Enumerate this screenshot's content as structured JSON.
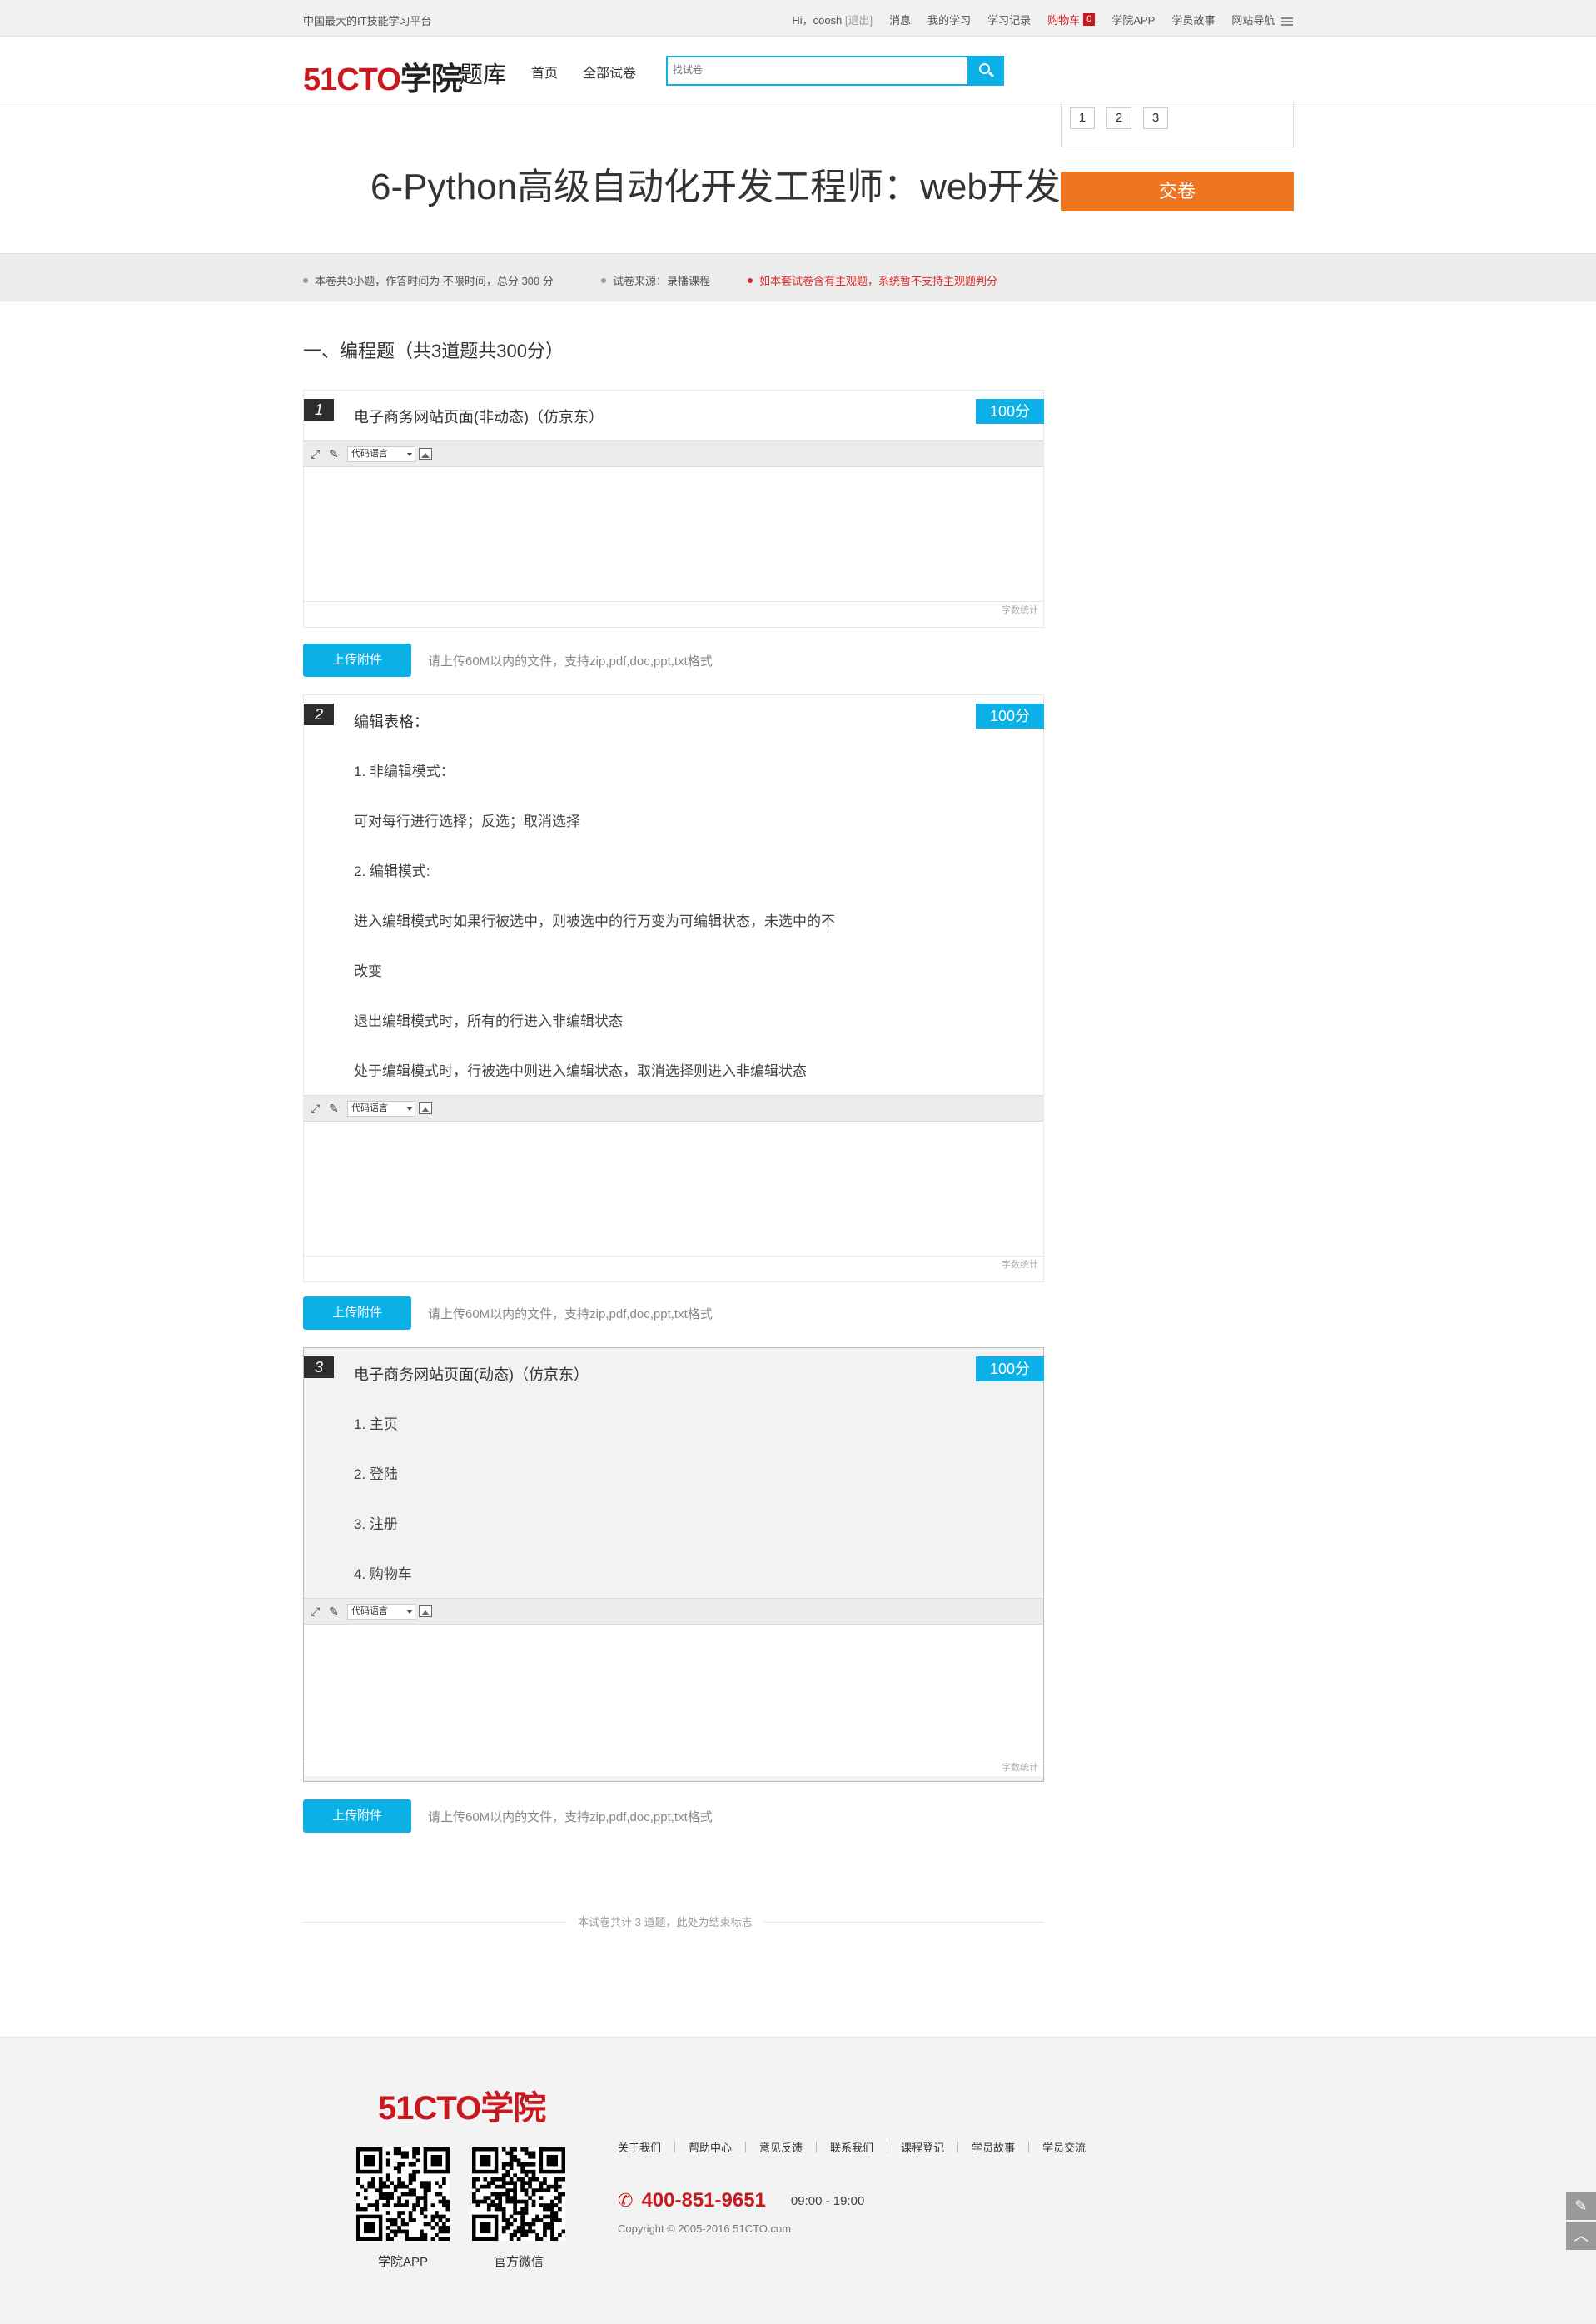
{
  "topbar": {
    "slogan": "中国最大的IT技能学习平台",
    "greeting": "Hi，coosh",
    "logout": "[退出]",
    "links": [
      "消息",
      "我的学习",
      "学习记录"
    ],
    "cart_label": "购物车",
    "cart_count": "0",
    "app_label": "学院APP",
    "stories_label": "学员故事",
    "site_nav_label": "网站导航"
  },
  "header": {
    "logo_num": "51CTO",
    "logo_cn": "学院",
    "logo_sub": "题库",
    "nav": [
      "首页",
      "全部试卷"
    ],
    "search_placeholder": "找试卷"
  },
  "exam": {
    "title": "6-Python高级自动化开发工程师：web开发",
    "side_nums": [
      "1",
      "2",
      "3"
    ],
    "submit_label": "交卷"
  },
  "info": {
    "summary": "本卷共3小题，作答时间为 不限时间，总分 300 分",
    "source": "试卷来源：录播课程",
    "warning": "如本套试卷含有主观题，系统暂不支持主观题判分"
  },
  "section": {
    "title": "一、编程题（共3道题共300分）"
  },
  "questions": [
    {
      "num": "1",
      "score": "100分",
      "title": "电子商务网站页面(非动态)（仿京东）",
      "lines": []
    },
    {
      "num": "2",
      "score": "100分",
      "title": "编辑表格：",
      "lines": [
        "1. 非编辑模式：",
        "可对每行进行选择；反选；取消选择",
        "2. 编辑模式:",
        "进入编辑模式时如果行被选中，则被选中的行万变为可编辑状态，未选中的不",
        "改变",
        "退出编辑模式时，所有的行进入非编辑状态",
        "处于编辑模式时，行被选中则进入编辑状态，取消选择则进入非编辑状态"
      ]
    },
    {
      "num": "3",
      "score": "100分",
      "title": "电子商务网站页面(动态)（仿京东）",
      "lines": [
        "1. 主页",
        "2. 登陆",
        "3. 注册",
        "4. 购物车"
      ]
    }
  ],
  "editor": {
    "lang_label": "代码语言",
    "count_label": "字数统计"
  },
  "upload": {
    "button": "上传附件",
    "hint": "请上传60M以内的文件，支持zip,pdf,doc,ppt,txt格式"
  },
  "end_text": "本试卷共计 3 道题，此处为结束标志",
  "footer": {
    "logo_num": "51CTO",
    "logo_cn": "学院",
    "qr_app_label": "学院APP",
    "qr_wechat_label": "官方微信",
    "links": [
      "关于我们",
      "帮助中心",
      "意见反馈",
      "联系我们",
      "课程登记",
      "学员故事",
      "学员交流"
    ],
    "phone": "400-851-9651",
    "hours": "09:00 - 19:00",
    "copyright": "Copyright © 2005-2016 51CTO.com"
  },
  "colors": {
    "brand_red": "#c9191e",
    "accent_blue": "#0ab0e6",
    "submit_orange": "#ee7623"
  },
  "icons": {
    "search": "search-icon",
    "phone": "phone-icon",
    "menu": "menu-icon",
    "feedback": "edit-icon",
    "back_to_top": "chevron-up-icon"
  }
}
